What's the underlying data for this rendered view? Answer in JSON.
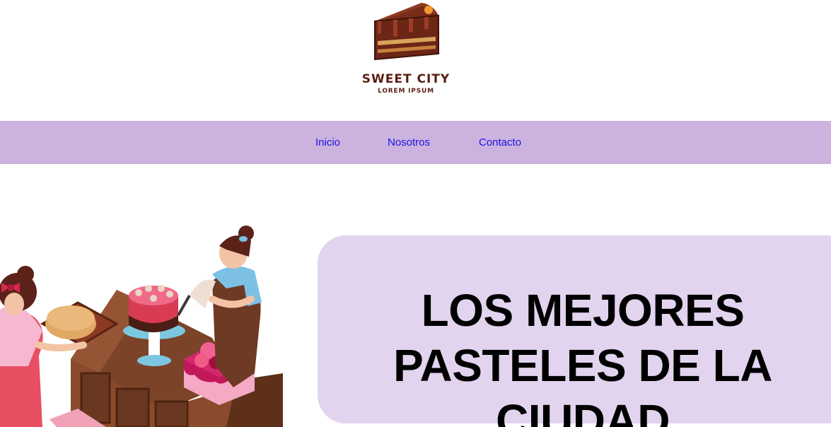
{
  "brand": {
    "name": "SWEET CITY",
    "tagline": "LOREM IPSUM",
    "logo_icon": "cake-slice-icon",
    "colors": {
      "chocolate": "#6b2616",
      "cream": "#d9a45a",
      "cherry": "#f29a2e"
    }
  },
  "nav": {
    "background": "#ccb3df",
    "link_color": "#1a13e0",
    "items": [
      {
        "label": "Inicio"
      },
      {
        "label": "Nosotros"
      },
      {
        "label": "Contacto"
      }
    ]
  },
  "hero": {
    "title_lines": [
      "LOS MEJORES",
      "PASTELES DE LA",
      "CIUDAD"
    ],
    "card_color": "#e2d4ef",
    "illustration_icon": "bakers-decorating-cakes-illustration"
  }
}
